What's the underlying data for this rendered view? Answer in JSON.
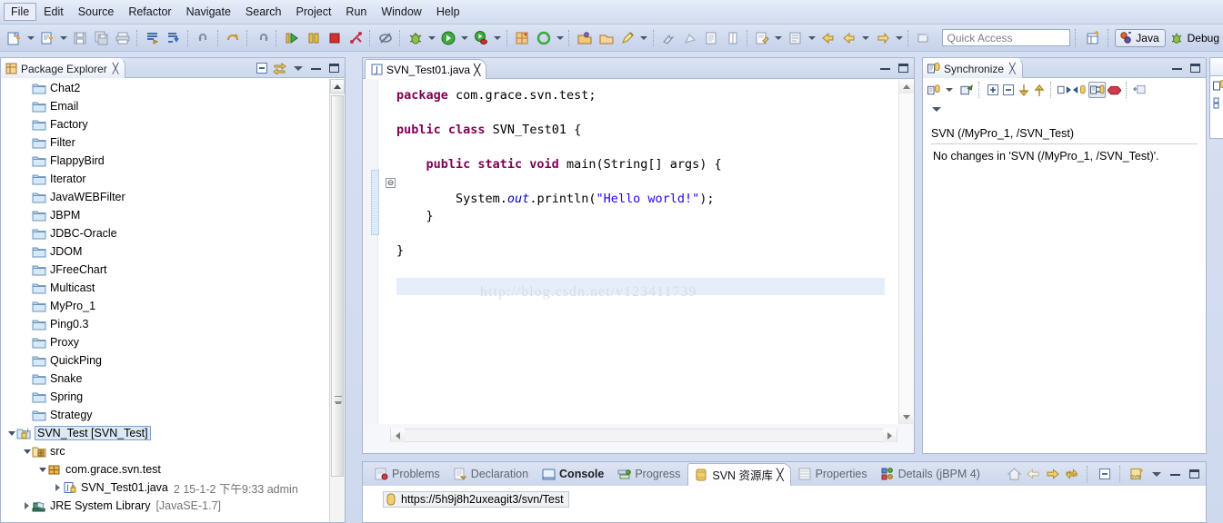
{
  "menu": {
    "items": [
      {
        "label": "File",
        "active": true
      },
      {
        "label": "Edit",
        "active": false
      },
      {
        "label": "Source",
        "active": false
      },
      {
        "label": "Refactor",
        "active": false
      },
      {
        "label": "Navigate",
        "active": false
      },
      {
        "label": "Search",
        "active": false
      },
      {
        "label": "Project",
        "active": false
      },
      {
        "label": "Run",
        "active": false
      },
      {
        "label": "Window",
        "active": false
      },
      {
        "label": "Help",
        "active": false
      }
    ]
  },
  "toolbar": {
    "quick_access_placeholder": "Quick Access",
    "perspective_java": "Java",
    "perspective_debug": "Debug",
    "icons": [
      "new-wizard-icon",
      "new-wizard-dropdown",
      "new-java-class-icon",
      "new-java-class-dropdown",
      "save-icon",
      "save-all-icon",
      "print-icon",
      "build-all-icon",
      "build-project-icon",
      "undo-icon",
      "redo-icon",
      "forward-icon",
      "run-icon",
      "suspend-icon",
      "terminate-icon",
      "disconnect-icon",
      "skip-breakpoints-icon",
      "debug-icon",
      "debug-dropdown",
      "run-green-icon",
      "run-dropdown",
      "coverage-icon",
      "coverage-dropdown",
      "new-plugin-icon",
      "external-tools-icon",
      "external-tools-dropdown",
      "open-type-icon",
      "open-task-icon",
      "search-icon",
      "search-dropdown",
      "next-annotation-icon",
      "previous-annotation-icon",
      "toggle-mark-icon",
      "toggle-block-icon",
      "last-edit-icon",
      "last-edit-dropdown",
      "pin-editor-icon",
      "pin-dropdown",
      "back-icon",
      "forward-yellow-icon",
      "forward-dropdown",
      "next-edit-dropdown",
      "new-window-icon",
      "open-perspective-icon"
    ]
  },
  "package_explorer": {
    "tab_label": "Package Explorer",
    "tab_close": "╳",
    "tools": [
      "collapse-all-icon",
      "link-with-editor-icon",
      "view-menu-icon",
      "minimize-icon",
      "maximize-icon"
    ],
    "items": [
      {
        "label": "Chat2",
        "icon": "folder-icon",
        "indent": 1,
        "twisty": "none",
        "selected": false
      },
      {
        "label": "Email",
        "icon": "folder-icon",
        "indent": 1,
        "twisty": "none",
        "selected": false
      },
      {
        "label": "Factory",
        "icon": "folder-icon",
        "indent": 1,
        "twisty": "none",
        "selected": false
      },
      {
        "label": "Filter",
        "icon": "folder-icon",
        "indent": 1,
        "twisty": "none",
        "selected": false
      },
      {
        "label": "FlappyBird",
        "icon": "folder-icon",
        "indent": 1,
        "twisty": "none",
        "selected": false
      },
      {
        "label": "Iterator",
        "icon": "folder-icon",
        "indent": 1,
        "twisty": "none",
        "selected": false
      },
      {
        "label": "JavaWEBFilter",
        "icon": "folder-icon",
        "indent": 1,
        "twisty": "none",
        "selected": false
      },
      {
        "label": "JBPM",
        "icon": "folder-icon",
        "indent": 1,
        "twisty": "none",
        "selected": false
      },
      {
        "label": "JDBC-Oracle",
        "icon": "folder-icon",
        "indent": 1,
        "twisty": "none",
        "selected": false
      },
      {
        "label": "JDOM",
        "icon": "folder-icon",
        "indent": 1,
        "twisty": "none",
        "selected": false
      },
      {
        "label": "JFreeChart",
        "icon": "folder-icon",
        "indent": 1,
        "twisty": "none",
        "selected": false
      },
      {
        "label": "Multicast",
        "icon": "folder-icon",
        "indent": 1,
        "twisty": "none",
        "selected": false
      },
      {
        "label": "MyPro_1",
        "icon": "folder-icon",
        "indent": 1,
        "twisty": "none",
        "selected": false
      },
      {
        "label": "Ping0.3",
        "icon": "folder-icon",
        "indent": 1,
        "twisty": "none",
        "selected": false
      },
      {
        "label": "Proxy",
        "icon": "folder-icon",
        "indent": 1,
        "twisty": "none",
        "selected": false
      },
      {
        "label": "QuickPing",
        "icon": "folder-icon",
        "indent": 1,
        "twisty": "none",
        "selected": false
      },
      {
        "label": "Snake",
        "icon": "folder-icon",
        "indent": 1,
        "twisty": "none",
        "selected": false
      },
      {
        "label": "Spring",
        "icon": "folder-icon",
        "indent": 1,
        "twisty": "none",
        "selected": false
      },
      {
        "label": "Strategy",
        "icon": "folder-icon",
        "indent": 1,
        "twisty": "none",
        "selected": false
      },
      {
        "label": "SVN_Test [SVN_Test]",
        "icon": "java-project-svn-icon",
        "indent": 0,
        "twisty": "open",
        "selected": true
      },
      {
        "label": "src",
        "icon": "source-folder-icon",
        "indent": 1,
        "twisty": "open",
        "selected": false
      },
      {
        "label": "com.grace.svn.test",
        "icon": "package-icon",
        "indent": 2,
        "twisty": "open",
        "selected": false
      },
      {
        "label": "SVN_Test01.java",
        "icon": "java-file-svn-icon",
        "indent": 3,
        "twisty": "closed",
        "selected": false,
        "sub": "2  15-1-2 下午9:33   admin"
      },
      {
        "label": "JRE System Library",
        "icon": "jre-library-icon",
        "indent": 1,
        "twisty": "closed",
        "selected": false,
        "sub": "[JavaSE-1.7]"
      }
    ]
  },
  "editor": {
    "tab_label": "SVN_Test01.java",
    "tab_icon": "java-file-icon",
    "tab_close": "╳",
    "tools": [
      "minimize-icon",
      "maximize-icon"
    ],
    "fold_marker": "⊖",
    "watermark": "http://blog.csdn.net/v123411739",
    "code_lines": [
      {
        "segments": [
          {
            "t": "package",
            "c": "kw"
          },
          {
            "t": " com.grace.svn.test;",
            "c": ""
          }
        ]
      },
      {
        "segments": []
      },
      {
        "segments": [
          {
            "t": "public class",
            "c": "kw"
          },
          {
            "t": " SVN_Test01 {",
            "c": ""
          }
        ]
      },
      {
        "segments": []
      },
      {
        "segments": [
          {
            "t": "    public static void",
            "c": "kw"
          },
          {
            "t": " main(String[] args) {",
            "c": ""
          }
        ]
      },
      {
        "segments": []
      },
      {
        "segments": [
          {
            "t": "        System.",
            "c": ""
          },
          {
            "t": "out",
            "c": "fld"
          },
          {
            "t": ".println(",
            "c": ""
          },
          {
            "t": "\"Hello world!\"",
            "c": "str"
          },
          {
            "t": ");",
            "c": ""
          }
        ]
      },
      {
        "segments": [
          {
            "t": "    }",
            "c": ""
          }
        ]
      },
      {
        "segments": []
      },
      {
        "segments": [
          {
            "t": "}",
            "c": ""
          }
        ]
      }
    ]
  },
  "synchronize": {
    "tab_label": "Synchronize",
    "tab_close": "╳",
    "tools": [
      "synchronize-icon",
      "synchronize-dropdown",
      "open-in-compare-icon",
      "expand-all-icon",
      "collapse-all-icon",
      "next-change-icon",
      "previous-change-icon",
      "incoming-mode-icon",
      "outgoing-mode-icon",
      "both-mode-icon",
      "conflicts-mode-icon",
      "pin-icon",
      "view-menu-icon",
      "minimize-icon",
      "maximize-icon"
    ],
    "scope_title": "SVN (/MyPro_1, /SVN_Test)",
    "message": "No changes in 'SVN (/MyPro_1, /SVN_Test)'."
  },
  "bottom_view": {
    "tabs": [
      {
        "label": "Problems",
        "icon": "problems-icon",
        "active": false,
        "bold": false
      },
      {
        "label": "Declaration",
        "icon": "declaration-icon",
        "active": false,
        "bold": false
      },
      {
        "label": "Console",
        "icon": "console-icon",
        "active": false,
        "bold": true
      },
      {
        "label": "Progress",
        "icon": "progress-icon",
        "active": false,
        "bold": false
      },
      {
        "label": "SVN 资源库",
        "icon": "svn-repo-icon",
        "active": true,
        "bold": false,
        "close": "╳"
      },
      {
        "label": "Properties",
        "icon": "properties-icon",
        "active": false,
        "bold": false
      },
      {
        "label": "Details (jBPM 4)",
        "icon": "details-icon",
        "active": false,
        "bold": false
      }
    ],
    "tools": [
      "home-icon",
      "back-icon",
      "forward-icon",
      "refresh-icon",
      "collapse-all-icon",
      "new-repository-location-icon",
      "view-menu-icon",
      "minimize-icon",
      "maximize-icon"
    ],
    "repository_url": "https://5h9j8h2uxeagit3/svn/Test",
    "repository_icon": "svn-repo-node-icon"
  },
  "colors": {
    "chrome": "#cfd9ee",
    "tab_active": "#fdfdff",
    "keyword": "#7f0055",
    "string": "#2a00ff",
    "field": "#0000c0",
    "selection": "#dbe8f7",
    "highlight_line": "#e6eefb",
    "folder": "#a8cce8"
  }
}
